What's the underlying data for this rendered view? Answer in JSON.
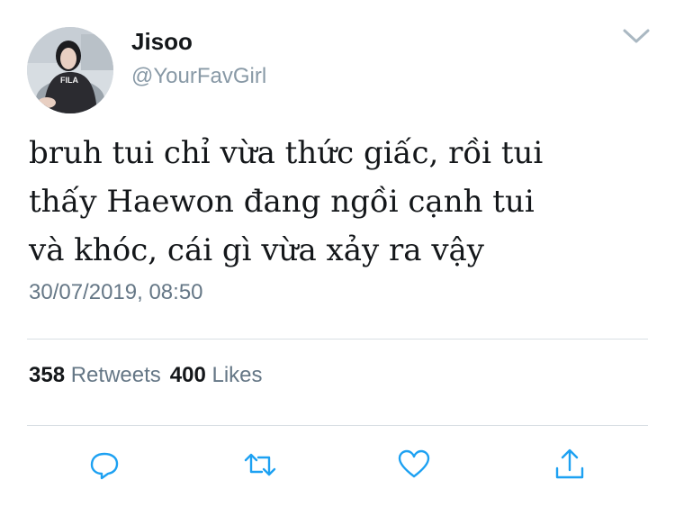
{
  "author": {
    "display_name": "Jisoo",
    "handle": "@YourFavGirl",
    "avatar_shirt_text": "FILA"
  },
  "tweet": {
    "text": "bruh tui chỉ vừa thức giấc, rồi tui\nthấy Haewon đang ngồi cạnh tui\nvà khóc, cái gì vừa xảy ra vậy",
    "timestamp": "30/07/2019, 08:50"
  },
  "stats": {
    "retweets_count": "358",
    "retweets_label": "Retweets",
    "likes_count": "400",
    "likes_label": "Likes"
  },
  "actions": [
    {
      "name": "reply",
      "icon": "reply-icon"
    },
    {
      "name": "retweet",
      "icon": "retweet-icon"
    },
    {
      "name": "like",
      "icon": "heart-icon"
    },
    {
      "name": "share",
      "icon": "share-icon"
    }
  ],
  "colors": {
    "text_primary": "#14171a",
    "text_secondary": "#657786",
    "handle": "#8899a6",
    "icon": "#1da1f2",
    "divider": "#d9dfe4"
  }
}
